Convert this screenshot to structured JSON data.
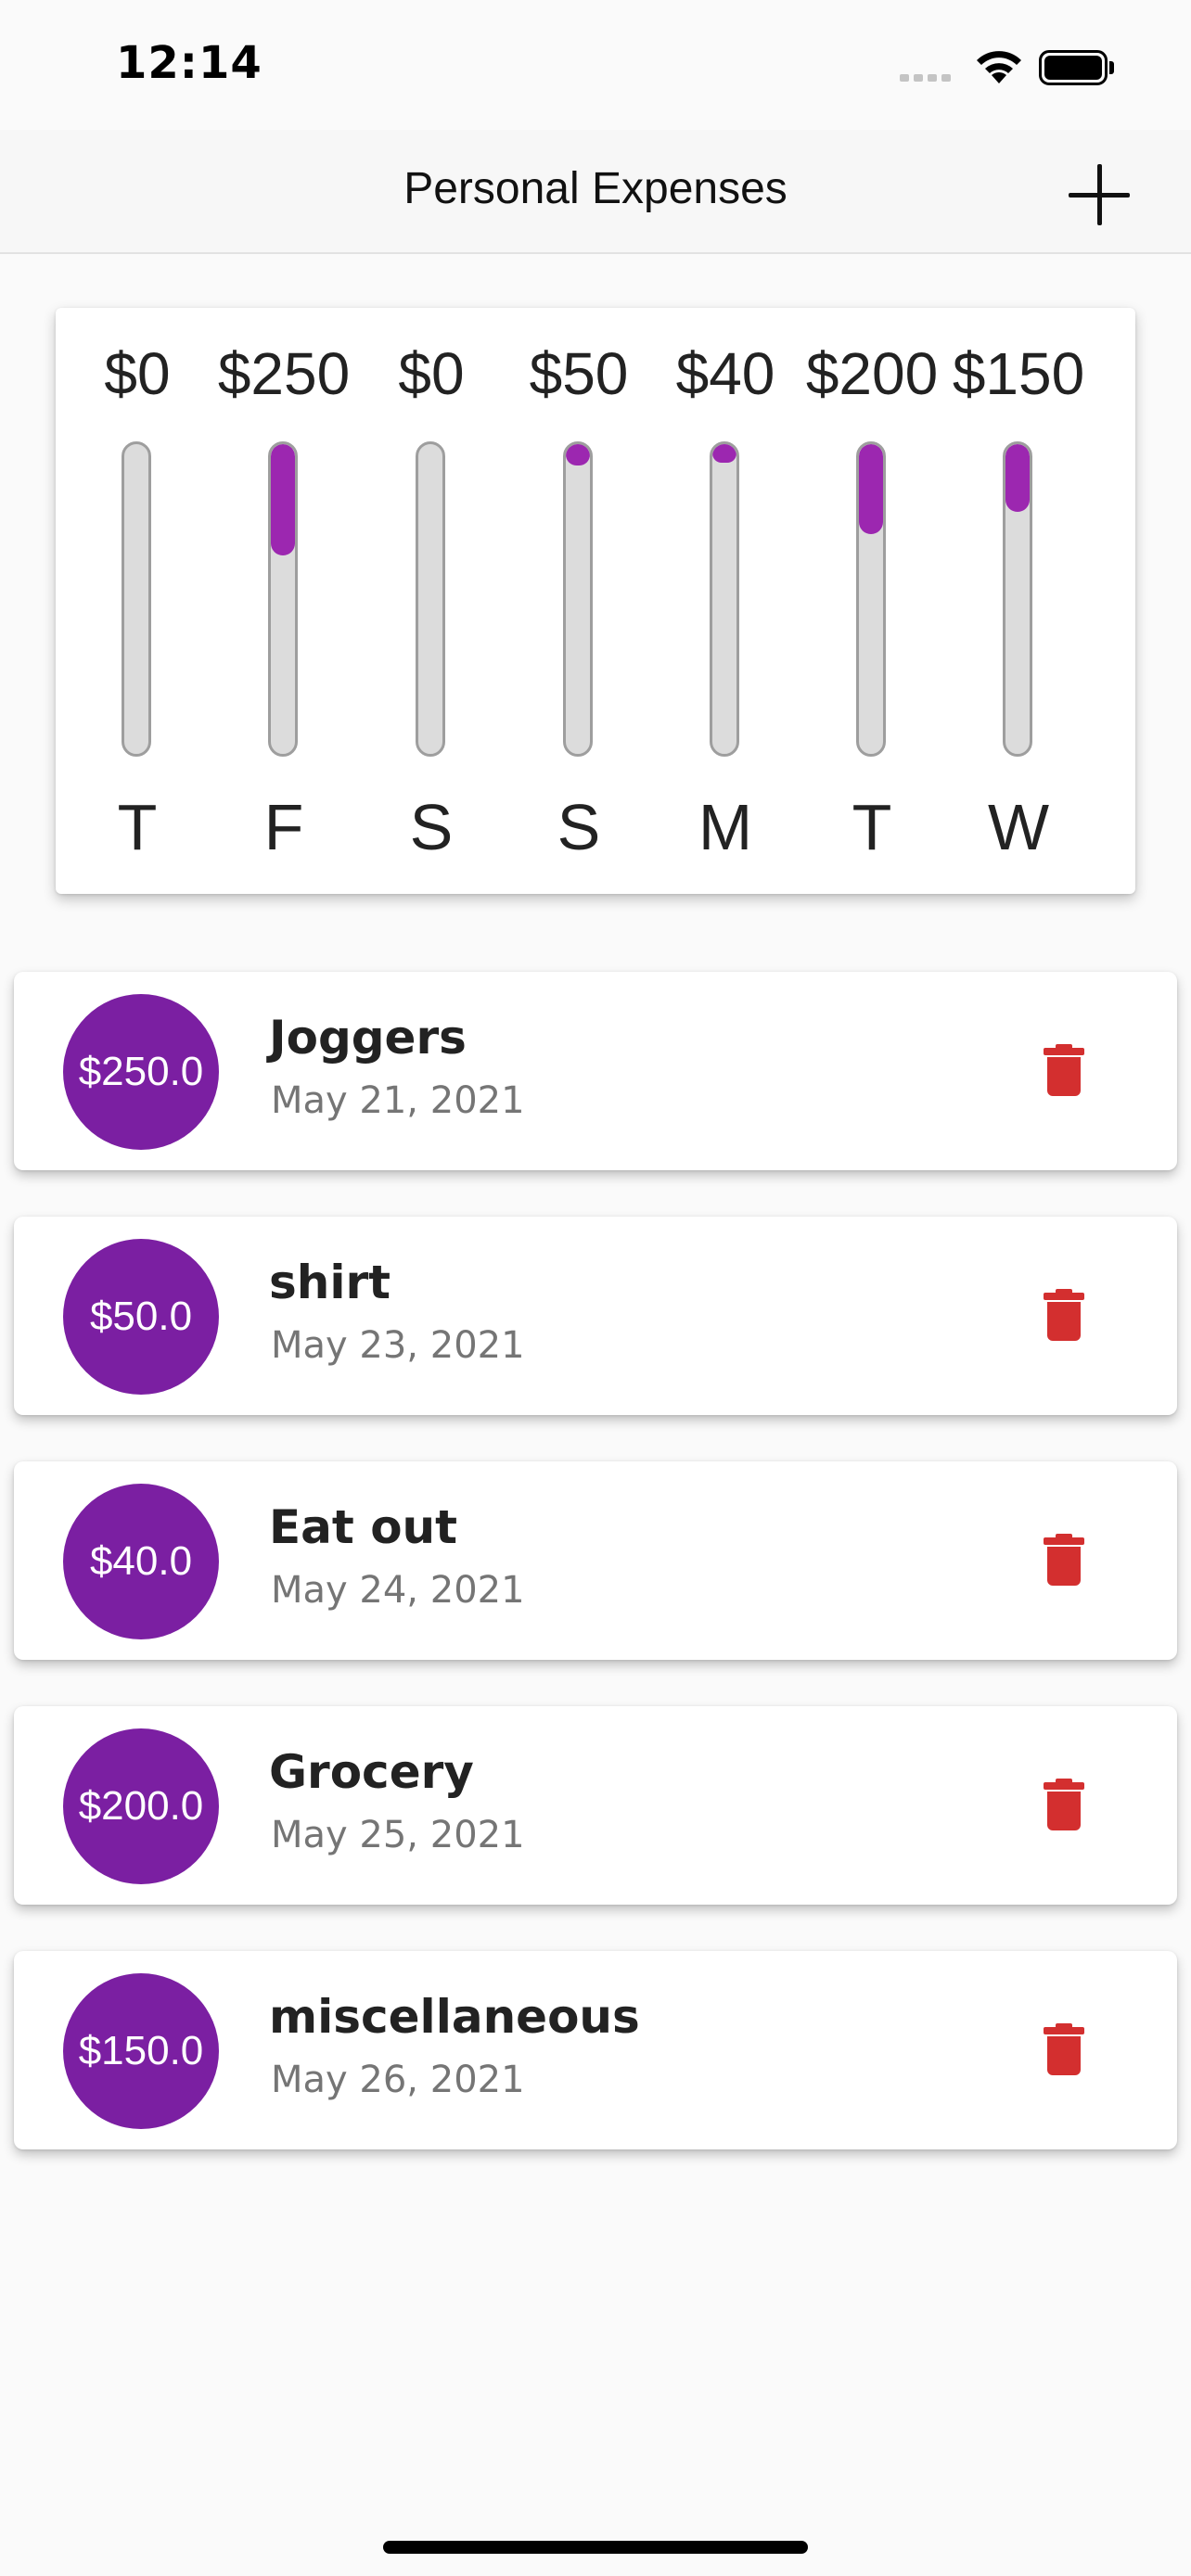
{
  "status_bar": {
    "time": "12:14"
  },
  "app_bar": {
    "title": "Personal Expenses",
    "add_icon": "plus-icon"
  },
  "chart": {
    "accent_color": "#9c27b0",
    "bars": [
      {
        "day": "T",
        "amount": "$0",
        "fraction": 0.0
      },
      {
        "day": "F",
        "amount": "$250",
        "fraction": 0.36
      },
      {
        "day": "S",
        "amount": "$0",
        "fraction": 0.0
      },
      {
        "day": "S",
        "amount": "$50",
        "fraction": 0.07
      },
      {
        "day": "M",
        "amount": "$40",
        "fraction": 0.06
      },
      {
        "day": "T",
        "amount": "$200",
        "fraction": 0.29
      },
      {
        "day": "W",
        "amount": "$150",
        "fraction": 0.22
      }
    ]
  },
  "transactions": [
    {
      "amount": "$250.0",
      "title": "Joggers",
      "date": "May 21, 2021"
    },
    {
      "amount": "$50.0",
      "title": "shirt",
      "date": "May 23, 2021"
    },
    {
      "amount": "$40.0",
      "title": "Eat out",
      "date": "May 24, 2021"
    },
    {
      "amount": "$200.0",
      "title": "Grocery",
      "date": "May 25, 2021"
    },
    {
      "amount": "$150.0",
      "title": "miscellaneous",
      "date": "May 26, 2021"
    }
  ],
  "colors": {
    "primary": "#7b1fa2",
    "bar_fill": "#9c27b0",
    "delete": "#d32f2f"
  }
}
